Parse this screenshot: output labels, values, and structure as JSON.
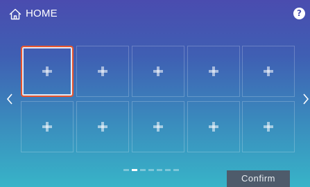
{
  "header": {
    "title": "HOME",
    "home_icon": "home-icon",
    "help_label": "?"
  },
  "grid": {
    "rows": 2,
    "columns": 5,
    "tile_icon": "plus-icon",
    "selected_index": 0
  },
  "navigation": {
    "prev_icon": "chevron-left-icon",
    "next_icon": "chevron-right-icon"
  },
  "pager": {
    "page_count": 7,
    "current_page": 2
  },
  "footer": {
    "confirm_label": "Confirm"
  },
  "colors": {
    "selection_border": "#e8542c",
    "confirm_bg": "#4e5b6b"
  }
}
